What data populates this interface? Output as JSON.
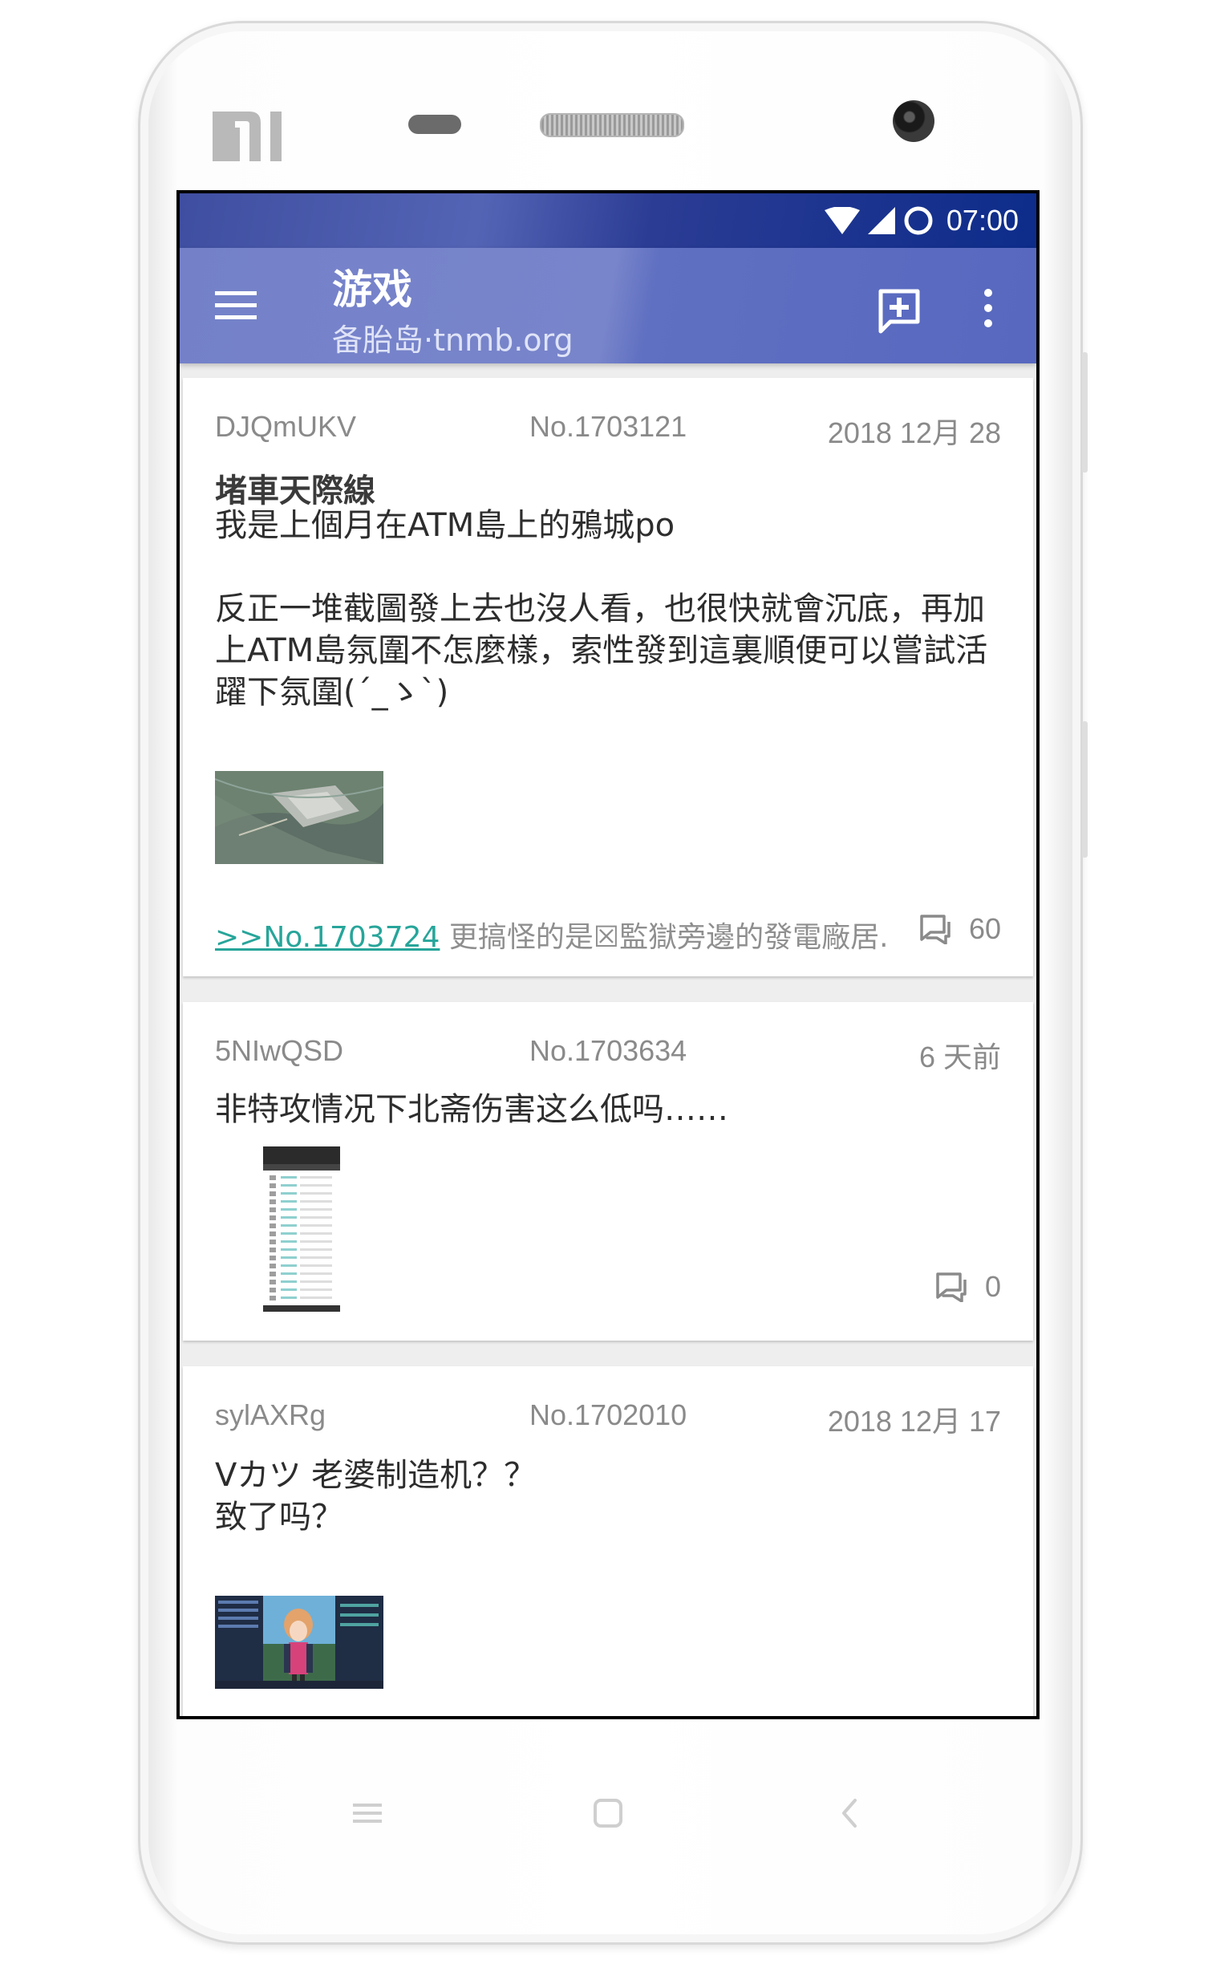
{
  "device": {
    "brand_logo": "mi-logo"
  },
  "status_bar": {
    "time": "07:00",
    "icons": [
      "wifi-icon",
      "signal-icon",
      "circle-notification-icon"
    ]
  },
  "app_bar": {
    "title": "游戏",
    "subtitle": "备胎岛·tnmb.org",
    "icons": [
      "hamburger-menu-icon",
      "new-post-icon",
      "more-vert-icon"
    ]
  },
  "threads": [
    {
      "author": "DJQmUKV",
      "number": "No.1703121",
      "time": "2018 12月 28",
      "title": "堵車天際線",
      "body": "我是上個月在ATM島上的鴉城po\n\n反正一堆截圖發上去也沒人看，也很快就會沉底，再加上ATM島氛圍不怎麼樣，索性發到這裏順便可以嘗試活躍下氛圍(´_ゝ`)",
      "thumbnail": "city-aerial-screenshot",
      "reply_link": ">>No.1703724",
      "reply_text": " 更搞怪的是☒監獄旁邊的發電廠居...",
      "reply_count": "60"
    },
    {
      "author": "5NIwQSD",
      "number": "No.1703634",
      "time": "6 天前",
      "title": "",
      "body": "非特攻情况下北斋伤害这么低吗……",
      "thumbnail": "phone-list-screenshot",
      "reply_count": "0"
    },
    {
      "author": "sylAXRg",
      "number": "No.1702010",
      "time": "2018 12月 17",
      "title": "",
      "body": "Vカツ 老婆制造机？？\n致了吗？",
      "thumbnail": "anime-character-screenshot"
    }
  ],
  "nav_bar": {
    "icons": [
      "nav-menu-icon",
      "nav-home-icon",
      "nav-back-icon"
    ]
  }
}
